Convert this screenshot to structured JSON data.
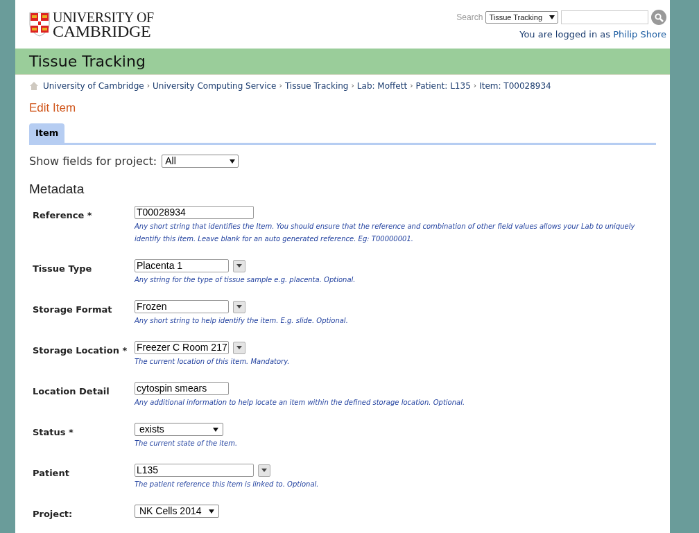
{
  "logo": {
    "line1": "UNIVERSITY OF",
    "line2": "CAMBRIDGE"
  },
  "search": {
    "label": "Search",
    "scope": "Tissue Tracking"
  },
  "login": {
    "prefix": "You are logged in as",
    "user": "Philip Shore"
  },
  "banner": {
    "title": "Tissue Tracking"
  },
  "breadcrumb": {
    "separator": "›",
    "items": [
      "University of Cambridge",
      "University Computing Service",
      "Tissue Tracking",
      "Lab: Moffett",
      "Patient: L135",
      "Item: T00028934"
    ]
  },
  "page_title": "Edit Item",
  "tabs": [
    {
      "label": "Item",
      "selected": true
    }
  ],
  "project_filter": {
    "label": "Show fields for project:",
    "value": "All"
  },
  "section_title": "Metadata",
  "fields": [
    {
      "kind": "text",
      "label": "Reference *",
      "value": "T00028934",
      "hint": "Any short string that identifies the Item. You should ensure that the reference and combination of other field values allows your Lab to uniquely identify this item. Leave blank for an auto generated reference. Eg: T00000001."
    },
    {
      "kind": "combo",
      "label": "Tissue Type",
      "value": "Placenta 1",
      "hint": "Any string for the type of tissue sample e.g. placenta. Optional."
    },
    {
      "kind": "combo",
      "label": "Storage Format",
      "value": "Frozen",
      "hint": "Any short string to help identify the item. E.g. slide. Optional."
    },
    {
      "kind": "combo",
      "label": "Storage Location *",
      "value": "Freezer C Room 217",
      "hint": "The current location of this item. Mandatory."
    },
    {
      "kind": "text",
      "label": "Location Detail",
      "value": "cytospin smears",
      "hint": "Any additional information to help locate an item within the defined storage location. Optional."
    },
    {
      "kind": "select",
      "label": "Status *",
      "value": "exists",
      "hint": "The current state of the item."
    },
    {
      "kind": "combo",
      "label": "Patient",
      "value": "L135",
      "hint": "The patient reference this item is linked to. Optional."
    },
    {
      "kind": "select",
      "label": "Project:",
      "value": "NK Cells 2014"
    }
  ]
}
